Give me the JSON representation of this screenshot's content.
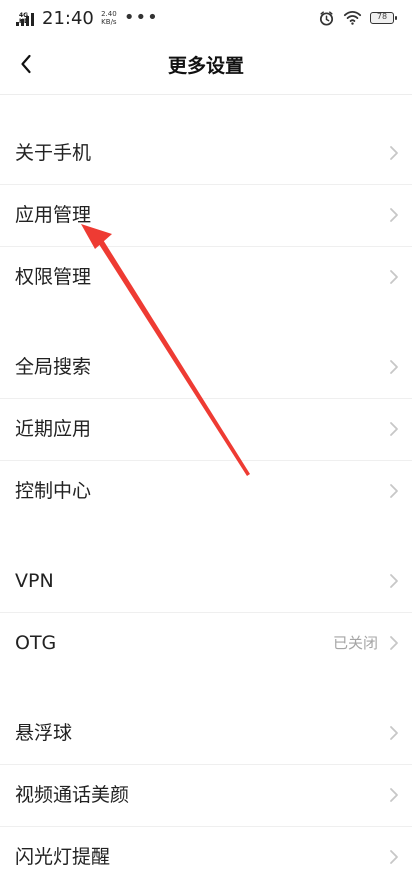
{
  "status_bar": {
    "signal_label": "4G HD",
    "time": "21:40",
    "speed_value": "2.40",
    "speed_unit": "KB/s",
    "dots": "•••",
    "battery": "78"
  },
  "header": {
    "title": "更多设置",
    "icons": {
      "back": "chevron-left-icon"
    }
  },
  "sections": {
    "first": [
      {
        "label": "关于手机"
      },
      {
        "label": "应用管理"
      },
      {
        "label": "权限管理"
      }
    ],
    "second": [
      {
        "label": "全局搜索"
      },
      {
        "label": "近期应用"
      },
      {
        "label": "控制中心"
      }
    ],
    "third": [
      {
        "label": "VPN"
      },
      {
        "label": "OTG",
        "value": "已关闭"
      }
    ],
    "fourth": [
      {
        "label": "悬浮球"
      },
      {
        "label": "视频通话美颜"
      },
      {
        "label": "闪光灯提醒"
      }
    ]
  },
  "colors": {
    "annotation_arrow": "#ee3b33"
  }
}
